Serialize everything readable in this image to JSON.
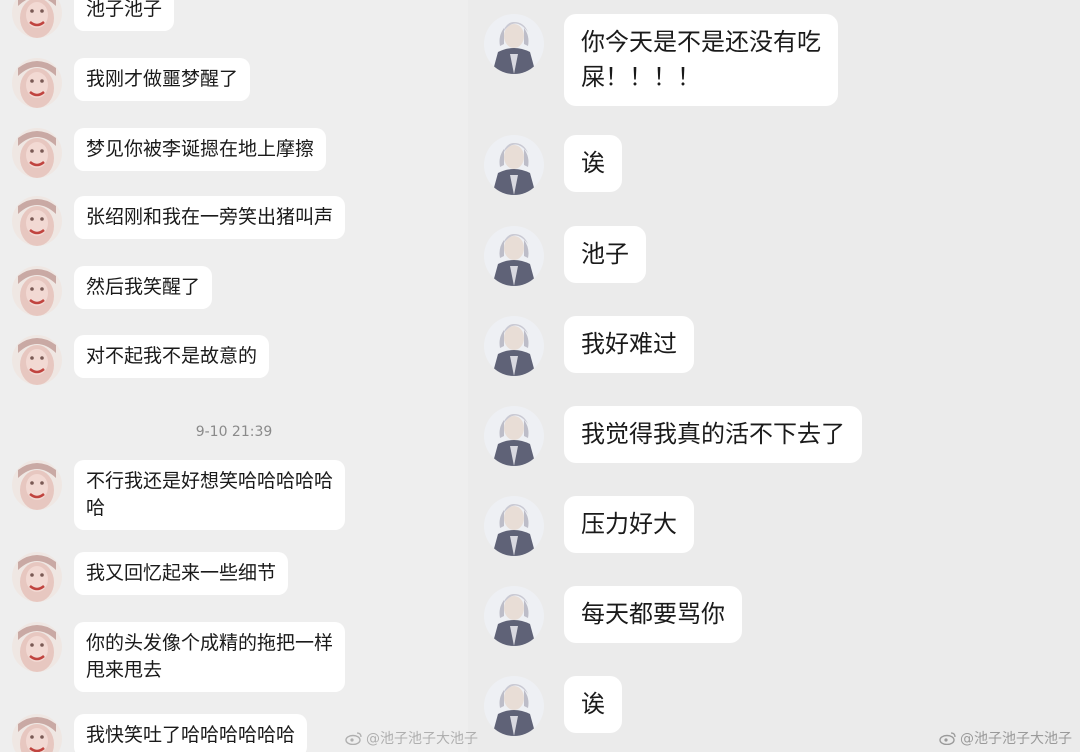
{
  "left_chat": {
    "messages": [
      {
        "text": "池子池子"
      },
      {
        "text": "我刚才做噩梦醒了"
      },
      {
        "text": "梦见你被李诞摁在地上摩擦"
      },
      {
        "text": "张绍刚和我在一旁笑出猪叫声"
      },
      {
        "text": "然后我笑醒了"
      },
      {
        "text": "对不起我不是故意的"
      },
      {
        "text": "不行我还是好想笑哈哈哈哈哈\n哈"
      },
      {
        "text": "我又回忆起来一些细节"
      },
      {
        "text": "你的头发像个成精的拖把一样\n甩来甩去"
      },
      {
        "text": "我快笑吐了哈哈哈哈哈哈"
      }
    ],
    "timestamp": "9-10 21:39"
  },
  "right_chat": {
    "messages": [
      {
        "text": "你今天是不是还没有吃\n屎！！！！"
      },
      {
        "text": "诶"
      },
      {
        "text": "池子"
      },
      {
        "text": "我好难过"
      },
      {
        "text": "我觉得我真的活不下去了"
      },
      {
        "text": "压力好大"
      },
      {
        "text": "每天都要骂你"
      },
      {
        "text": "诶"
      }
    ]
  },
  "watermarks": {
    "left": "@池子池子大池子",
    "right": "@池子池子大池子"
  },
  "icons": {
    "weibo": "weibo-logo-icon"
  },
  "colors": {
    "background": "#ececec",
    "bubble": "#ffffff",
    "timestamp": "#8a8a8a"
  }
}
